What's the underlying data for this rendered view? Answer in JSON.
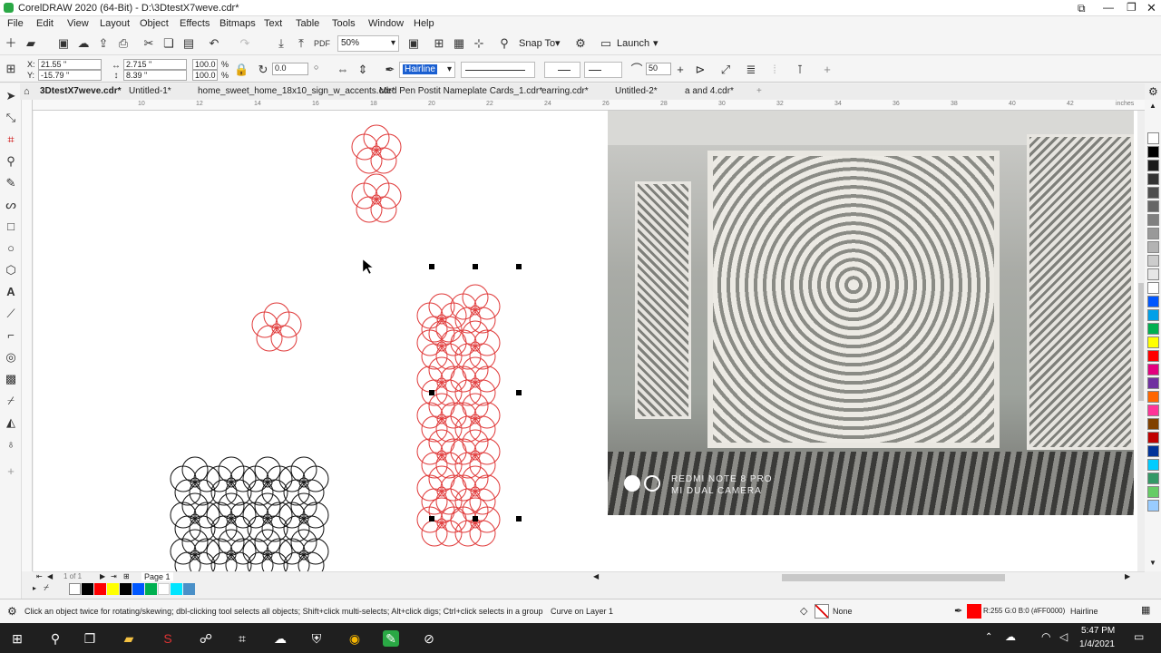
{
  "window": {
    "title": "CorelDRAW 2020 (64-Bit) - D:\\3DtestX7weve.cdr*"
  },
  "menu": [
    "File",
    "Edit",
    "View",
    "Layout",
    "Object",
    "Effects",
    "Bitmaps",
    "Text",
    "Table",
    "Tools",
    "Window",
    "Help"
  ],
  "toolbar": {
    "zoom": "50%",
    "snap_to": "Snap To",
    "launch": "Launch"
  },
  "props": {
    "x": "21.55 \"",
    "y": "-15.79 \"",
    "w": "2.715 \"",
    "h": "8.39 \"",
    "scale_x": "100.0",
    "scale_y": "100.0",
    "pct": "%",
    "angle": "0.0",
    "outline": "Hairline",
    "size": "50"
  },
  "tabs": [
    "3DtestX7weve.cdr*",
    "Untitled-1*",
    "home_sweet_home_18x10_sign_w_accents.cdr*",
    "Med Pen Postit Nameplate Cards_1.cdr*",
    "earring.cdr*",
    "Untitled-2*",
    "a and 4.cdr*"
  ],
  "ruler": {
    "units": "inches",
    "ticks": [
      "10",
      "12",
      "14",
      "16",
      "18",
      "20",
      "22",
      "24",
      "26",
      "28",
      "30",
      "32",
      "34",
      "36",
      "38",
      "40",
      "42"
    ]
  },
  "photo": {
    "caption1": "REDMI NOTE 8 PRO",
    "caption2": "MI DUAL CAMERA"
  },
  "pagenav": {
    "of": "1 of 1",
    "page": "Page 1"
  },
  "status": {
    "hint": "Click an object twice for rotating/skewing; dbl-clicking tool selects all objects; Shift+click multi-selects; Alt+click digs; Ctrl+click selects in a group",
    "layer": "Curve on Layer 1",
    "fill": "None",
    "outline_color": "R:255 G:0 B:0 (#FF0000)",
    "outline_width": "Hairline"
  },
  "clock": {
    "time": "5:47 PM",
    "date": "1/4/2021"
  },
  "colors": {
    "selection_red": "#e23b3b",
    "black_outline": "#111111",
    "palette": [
      "#ffffff",
      "#000000",
      "#1a1a1a",
      "#333333",
      "#4d4d4d",
      "#666666",
      "#808080",
      "#999999",
      "#b3b3b3",
      "#cccccc",
      "#e6e6e6",
      "#ffffff",
      "#0057ff",
      "#00a0e9",
      "#00b050",
      "#ffff00",
      "#ff0000",
      "#e4007f",
      "#7030a0",
      "#ff6600",
      "#ff3399",
      "#804000",
      "#c00000",
      "#003399",
      "#00ccff",
      "#339966",
      "#66cc66",
      "#99ccff"
    ]
  }
}
